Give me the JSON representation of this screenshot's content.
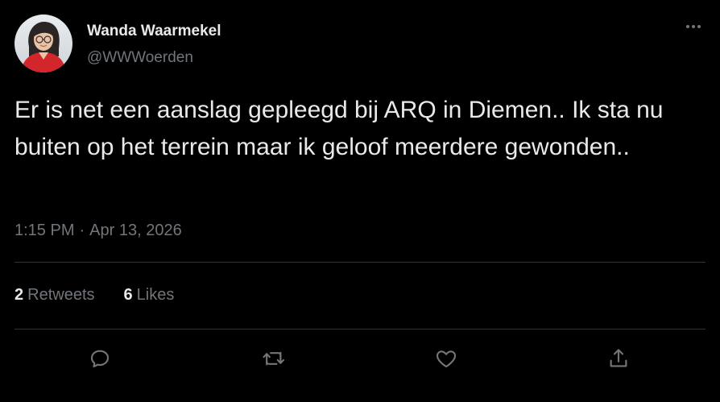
{
  "author": {
    "display_name": "Wanda Waarmekel",
    "handle": "@WWWoerden"
  },
  "tweet": {
    "text": "Er is net een aanslag gepleegd bij ARQ in Diemen.. Ik sta nu buiten op het terrein maar ik geloof meerdere gewonden..",
    "time": "1:15 PM",
    "separator": "·",
    "date": "Apr 13, 2026"
  },
  "stats": {
    "retweets_count": "2",
    "retweets_label": "Retweets",
    "likes_count": "6",
    "likes_label": "Likes"
  },
  "icons": {
    "more": "more-horizontal-icon",
    "reply": "reply-icon",
    "retweet": "retweet-icon",
    "like": "heart-icon",
    "share": "share-icon"
  },
  "colors": {
    "background": "#000000",
    "primary_text": "#e7e9ea",
    "secondary_text": "#71767b",
    "divider": "#2f3336"
  }
}
